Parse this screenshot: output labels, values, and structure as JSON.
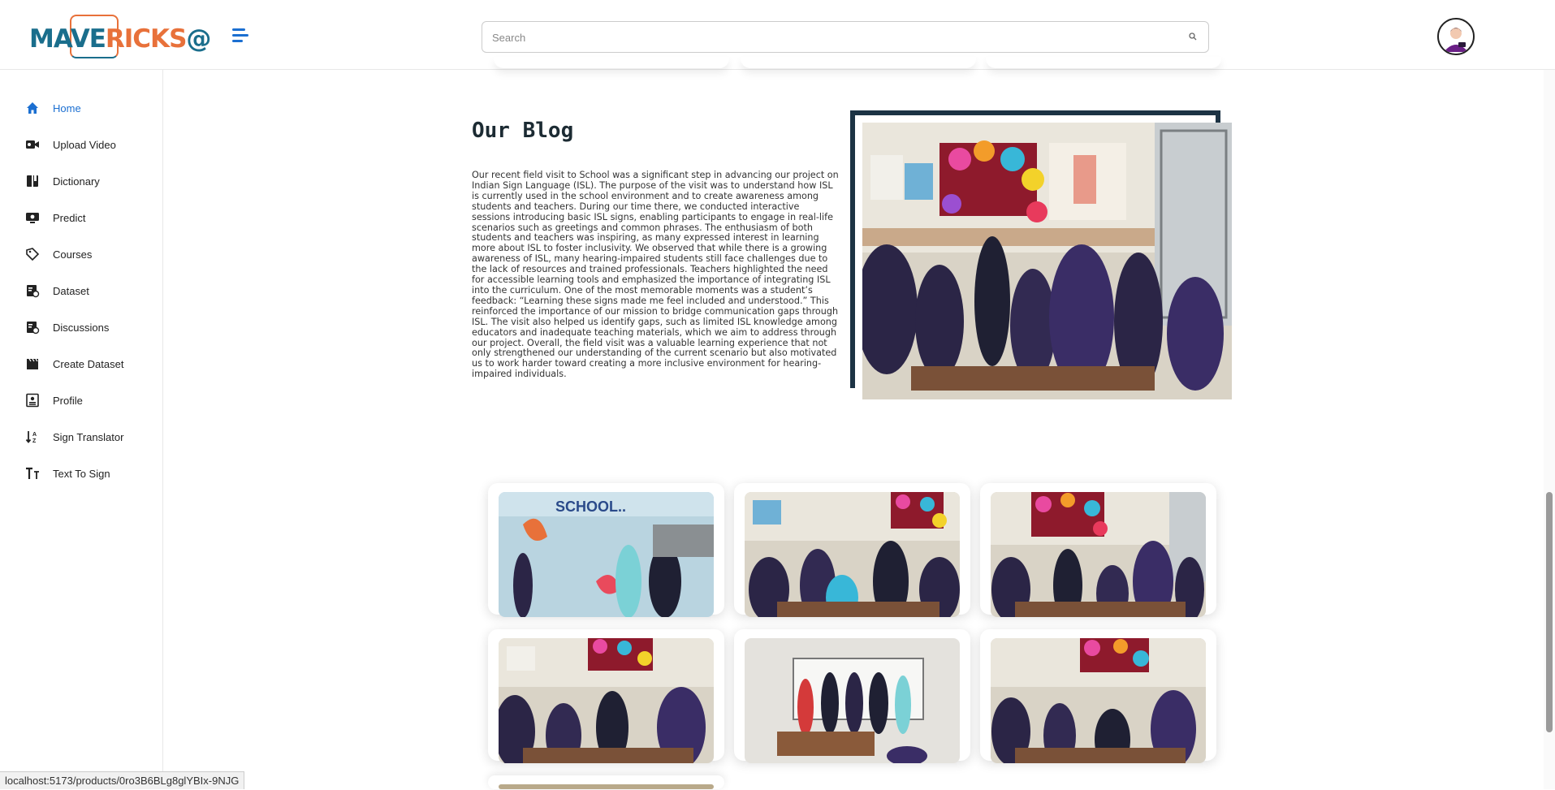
{
  "brand": {
    "logo_part1": "MAVE",
    "logo_part2": "RICKS",
    "logo_part3": "@",
    "primary_color": "#1a6e8c",
    "accent_color": "#e8713a"
  },
  "header": {
    "search_placeholder": "Search",
    "search_icon": "search-icon",
    "menu_icon": "hamburger-menu-icon",
    "avatar_icon": "user-avatar"
  },
  "sidebar": {
    "items": [
      {
        "label": "Home",
        "icon": "home-icon",
        "active": true
      },
      {
        "label": "Upload Video",
        "icon": "video-camera-icon",
        "active": false
      },
      {
        "label": "Dictionary",
        "icon": "book-icon",
        "active": false
      },
      {
        "label": "Predict",
        "icon": "monitor-icon",
        "active": false
      },
      {
        "label": "Courses",
        "icon": "tag-icon",
        "active": false
      },
      {
        "label": "Dataset",
        "icon": "dataset-icon",
        "active": false
      },
      {
        "label": "Discussions",
        "icon": "discussion-icon",
        "active": false
      },
      {
        "label": "Create Dataset",
        "icon": "clapperboard-icon",
        "active": false
      },
      {
        "label": "Profile",
        "icon": "profile-icon",
        "active": false
      },
      {
        "label": "Sign Translator",
        "icon": "sort-az-icon",
        "active": false
      },
      {
        "label": "Text To Sign",
        "icon": "text-icon",
        "active": false
      }
    ]
  },
  "blog": {
    "title": "Our Blog",
    "body": "Our recent field visit to School was a significant step in advancing our project on Indian Sign Language (ISL). The purpose of the visit was to understand how ISL is currently used in the school environment and to create awareness among students and teachers. During our time there, we conducted interactive sessions introducing basic ISL signs, enabling participants to engage in real-life scenarios such as greetings and common phrases. The enthusiasm of both students and teachers was inspiring, as many expressed interest in learning more about ISL to foster inclusivity. We observed that while there is a growing awareness of ISL, many hearing-impaired students still face challenges due to the lack of resources and trained professionals. Teachers highlighted the need for accessible learning tools and emphasized the importance of integrating ISL into the curriculum. One of the most memorable moments was a student’s feedback: “Learning these signs made me feel included and understood.” This reinforced the importance of our mission to bridge communication gaps through ISL. The visit also helped us identify gaps, such as limited ISL knowledge among educators and inadequate teaching materials, which we aim to address through our project. Overall, the field visit was a valuable learning experience that not only strengthened our understanding of the current scenario but also motivated us to work harder toward creating a more inclusive environment for hearing-impaired individuals.",
    "frame_color": "#1c3344"
  },
  "gallery": {
    "photos": [
      {
        "scene": "students-at-school-wall"
      },
      {
        "scene": "classroom-students-backs"
      },
      {
        "scene": "classroom-flower-wall"
      },
      {
        "scene": "classroom-students-backs"
      },
      {
        "scene": "group-in-front-of-whiteboard"
      },
      {
        "scene": "classroom-flower-wall"
      }
    ]
  },
  "status_bar": {
    "url": "localhost:5173/products/0ro3B6BLg8glYBIx-9NJG"
  }
}
